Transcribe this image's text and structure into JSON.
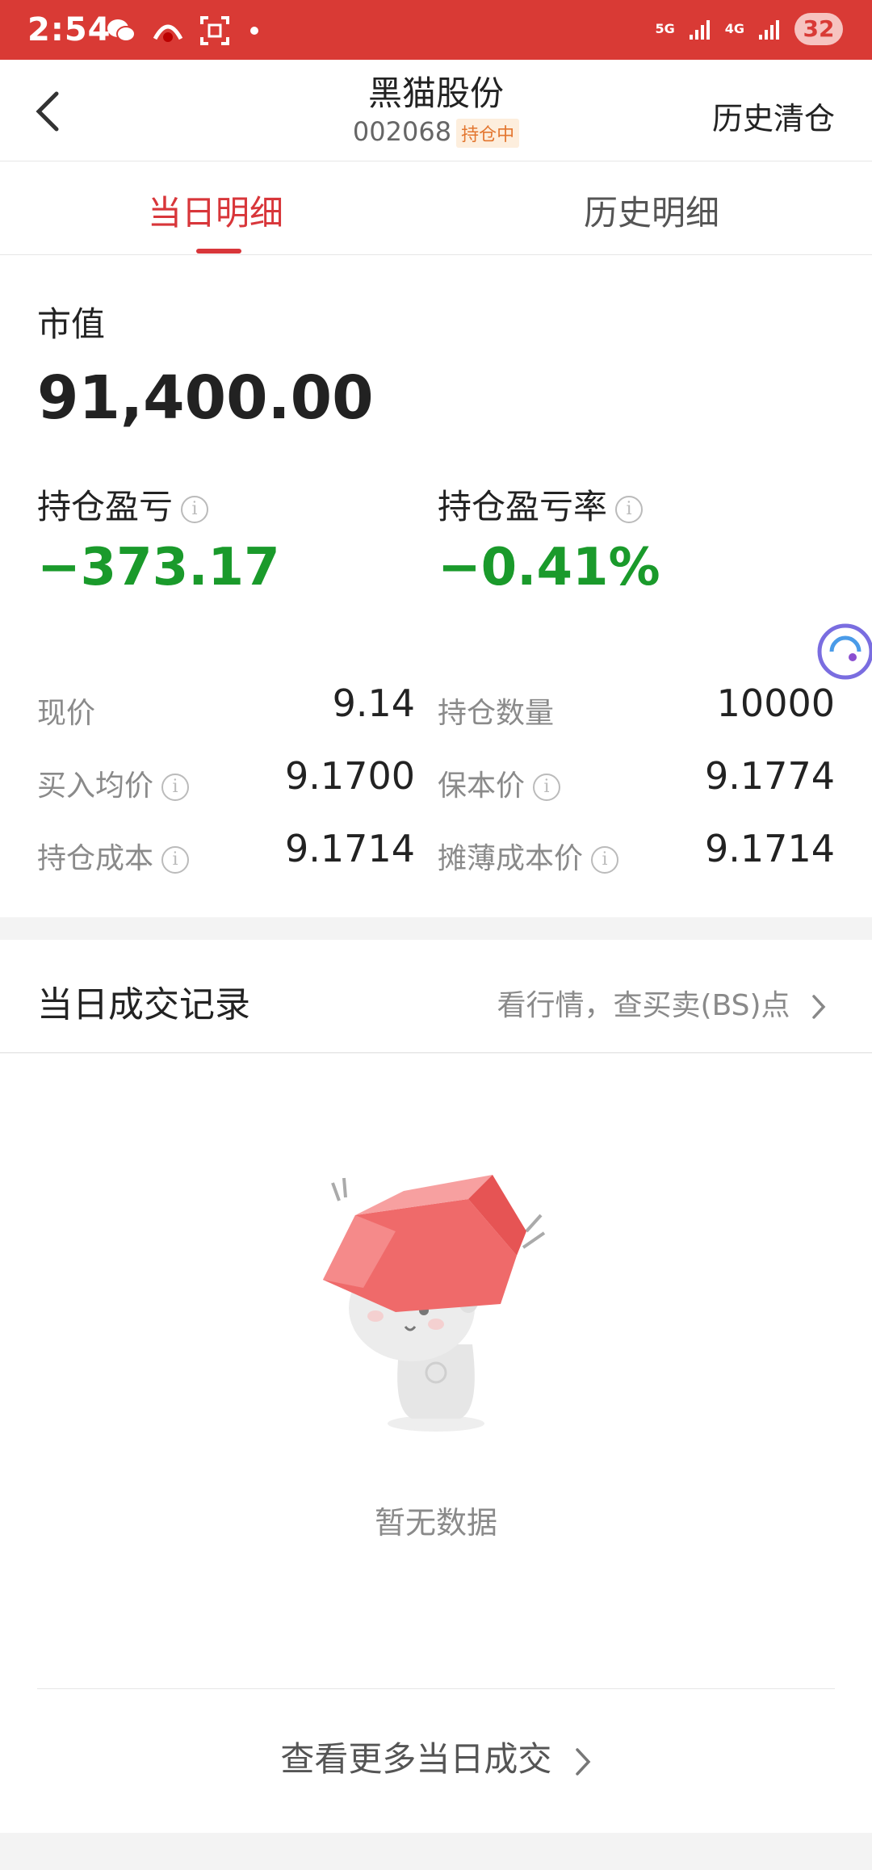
{
  "status_bar": {
    "time": "2:54",
    "icons": [
      "wechat-icon",
      "app-icon",
      "scan-icon"
    ],
    "network_1": "5G",
    "network_2": "4G",
    "battery": "32"
  },
  "header": {
    "title": "黑猫股份",
    "code": "002068",
    "status_tag": "持仓中",
    "right_action": "历史清仓"
  },
  "tabs": [
    {
      "label": "当日明细",
      "active": true
    },
    {
      "label": "历史明细",
      "active": false
    }
  ],
  "summary": {
    "market_value_label": "市值",
    "market_value": "91,400.00",
    "pnl_label": "持仓盈亏",
    "pnl_value": "−373.17",
    "pnl_rate_label": "持仓盈亏率",
    "pnl_rate_value": "−0.41%",
    "rows": {
      "r1": {
        "left_label": "现价",
        "left_value": "9.14",
        "right_label": "持仓数量",
        "right_value": "10000"
      },
      "r2": {
        "left_label": "买入均价",
        "left_value": "9.1700",
        "right_label": "保本价",
        "right_value": "9.1774"
      },
      "r3": {
        "left_label": "持仓成本",
        "left_value": "9.1714",
        "right_label": "摊薄成本价",
        "right_value": "9.1714"
      }
    },
    "colors": {
      "loss": "#1a9a2b",
      "accent": "#d8363a"
    }
  },
  "records": {
    "title": "当日成交记录",
    "link": "看行情，查买卖(BS)点",
    "empty_text": "暂无数据",
    "more": "查看更多当日成交"
  }
}
